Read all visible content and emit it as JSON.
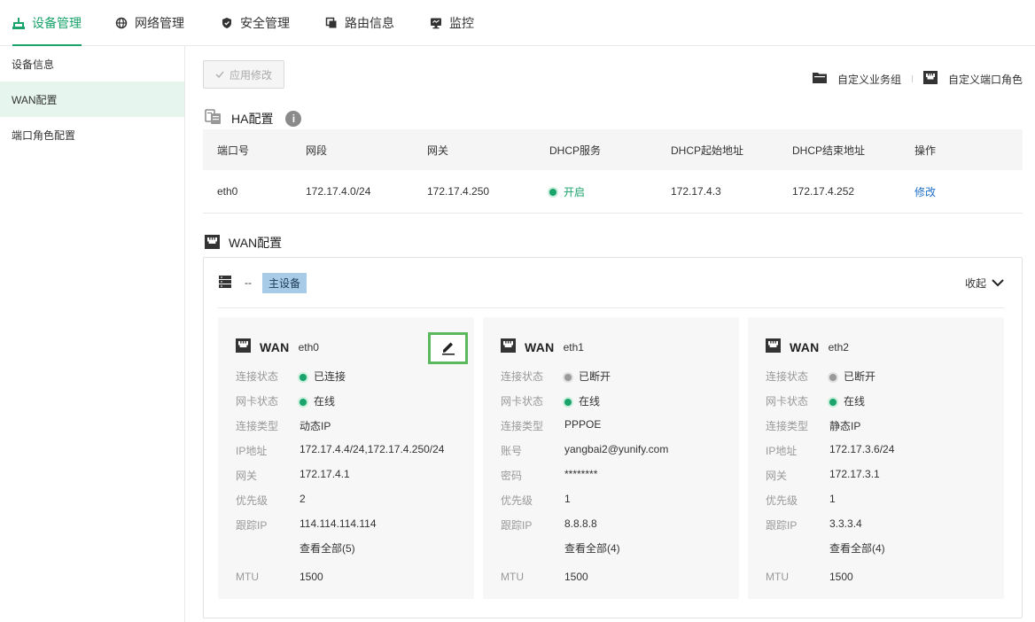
{
  "nav": {
    "tabs": [
      {
        "label": "设备管理",
        "icon": "network-device-icon",
        "active": true
      },
      {
        "label": "网络管理",
        "icon": "globe-icon"
      },
      {
        "label": "安全管理",
        "icon": "shield-icon"
      },
      {
        "label": "路由信息",
        "icon": "copy-icon"
      },
      {
        "label": "监控",
        "icon": "monitor-icon"
      }
    ]
  },
  "sidebar": {
    "items": [
      {
        "label": "设备信息"
      },
      {
        "label": "WAN配置",
        "active": true
      },
      {
        "label": "端口角色配置"
      }
    ]
  },
  "toolbar": {
    "apply_label": "应用修改",
    "custom_group_label": "自定义业务组",
    "custom_port_role_label": "自定义端口角色"
  },
  "ha": {
    "title": "HA配置",
    "info_glyph": "i",
    "columns": [
      "端口号",
      "网段",
      "网关",
      "DHCP服务",
      "DHCP起始地址",
      "DHCP结束地址",
      "操作"
    ],
    "row": {
      "port": "eth0",
      "segment": "172.17.4.0/24",
      "gateway": "172.17.4.250",
      "dhcp": "开启",
      "dhcp_start": "172.17.4.3",
      "dhcp_end": "172.17.4.252",
      "action": "修改"
    }
  },
  "wan": {
    "title": "WAN配置",
    "device_dash": "--",
    "device_tag": "主设备",
    "collapse_label": "收起",
    "wan_label": "WAN",
    "cards": [
      {
        "port": "eth0",
        "rows": [
          {
            "key": "连接状态",
            "value": "已连接",
            "status": "green"
          },
          {
            "key": "网卡状态",
            "value": "在线",
            "status": "green"
          },
          {
            "key": "连接类型",
            "value": "动态IP"
          },
          {
            "key": "IP地址",
            "value": "172.17.4.4/24,172.17.4.250/24"
          },
          {
            "key": "网关",
            "value": "172.17.4.1"
          },
          {
            "key": "优先级",
            "value": "2"
          },
          {
            "key": "跟踪IP",
            "value": "114.114.114.114"
          }
        ],
        "more": "查看全部(5)",
        "mtu_key": "MTU",
        "mtu": "1500"
      },
      {
        "port": "eth1",
        "rows": [
          {
            "key": "连接状态",
            "value": "已断开",
            "status": "gray"
          },
          {
            "key": "网卡状态",
            "value": "在线",
            "status": "green"
          },
          {
            "key": "连接类型",
            "value": "PPPOE"
          },
          {
            "key": "账号",
            "value": "yangbai2@yunify.com"
          },
          {
            "key": "密码",
            "value": "********"
          },
          {
            "key": "优先级",
            "value": "1"
          },
          {
            "key": "跟踪IP",
            "value": "8.8.8.8"
          }
        ],
        "more": "查看全部(4)",
        "mtu_key": "MTU",
        "mtu": "1500"
      },
      {
        "port": "eth2",
        "rows": [
          {
            "key": "连接状态",
            "value": "已断开",
            "status": "gray"
          },
          {
            "key": "网卡状态",
            "value": "在线",
            "status": "green"
          },
          {
            "key": "连接类型",
            "value": "静态IP"
          },
          {
            "key": "IP地址",
            "value": "172.17.3.6/24"
          },
          {
            "key": "网关",
            "value": "172.17.3.1"
          },
          {
            "key": "优先级",
            "value": "1"
          },
          {
            "key": "跟踪IP",
            "value": "3.3.3.4"
          }
        ],
        "more": "查看全部(4)",
        "mtu_key": "MTU",
        "mtu": "1500"
      }
    ]
  },
  "colors": {
    "accent": "#1aa36b",
    "link": "#1f6fc9",
    "highlight": "#5cb85c",
    "tag": "#a8cbe8"
  }
}
